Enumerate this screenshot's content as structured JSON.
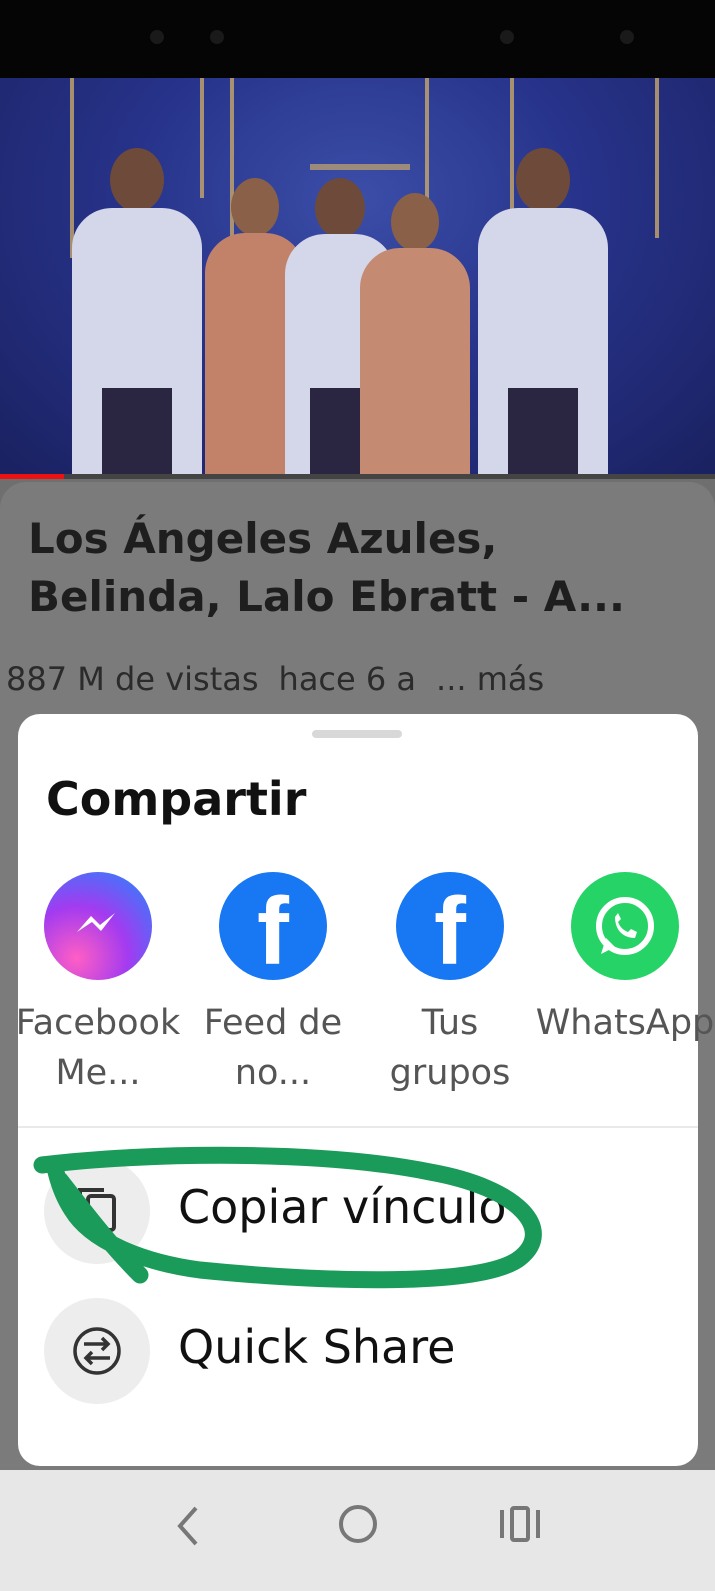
{
  "video": {
    "title": "Los Ángeles Azules, Belinda, Lalo Ebratt - A...",
    "views": "887 M de vistas",
    "age": "hace 6 a",
    "more": "... más",
    "progress": 0.09
  },
  "share_sheet": {
    "title": "Compartir",
    "apps": [
      {
        "label": "Facebook Me...",
        "icon": "messenger-icon"
      },
      {
        "label": "Feed de no...",
        "icon": "facebook-icon"
      },
      {
        "label": "Tus grupos",
        "icon": "facebook-icon"
      },
      {
        "label": "WhatsApp",
        "icon": "whatsapp-icon"
      }
    ],
    "actions": [
      {
        "label": "Copiar vínculo",
        "icon": "copy-icon"
      },
      {
        "label": "Quick Share",
        "icon": "quick-share-icon"
      }
    ]
  },
  "nav": {
    "icons": [
      "back-icon",
      "home-icon",
      "recents-icon"
    ]
  },
  "colors": {
    "facebook": "#1877f2",
    "whatsapp": "#25d366",
    "annotation": "#1a9b5a",
    "progress": "#ee1111"
  }
}
